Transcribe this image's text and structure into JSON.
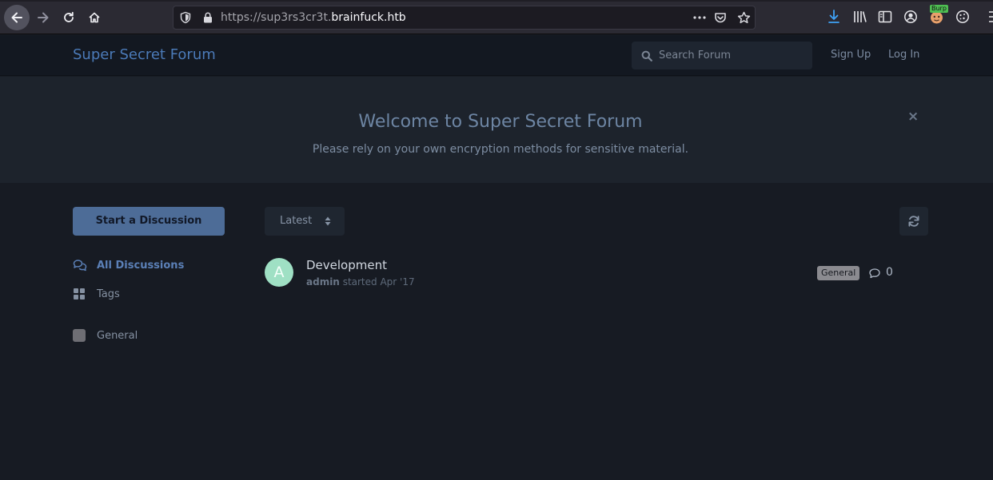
{
  "browser": {
    "url_prefix": "https://sup3rs3cr3t.",
    "url_host": "brainfuck.htb",
    "burp_badge": "Burp",
    "accent": "#3fa2f7"
  },
  "header": {
    "brand": "Super Secret Forum",
    "search_placeholder": "Search Forum",
    "signup": "Sign Up",
    "login": "Log In"
  },
  "hero": {
    "title": "Welcome to Super Secret Forum",
    "subtitle": "Please rely on your own encryption methods for sensitive material.",
    "close": "×"
  },
  "sidebar": {
    "start_button": "Start a Discussion",
    "items": [
      {
        "label": "All Discussions",
        "icon": "comments-icon"
      },
      {
        "label": "Tags",
        "icon": "grid-icon"
      },
      {
        "label": "General",
        "icon": "tag-square-icon"
      }
    ]
  },
  "toolbar": {
    "sort": "Latest"
  },
  "discussions": [
    {
      "avatar_letter": "A",
      "avatar_color": "#9fe0c4",
      "title": "Development",
      "author": "admin",
      "started_text": "started Apr '17",
      "tag": "General",
      "replies": "0"
    }
  ]
}
